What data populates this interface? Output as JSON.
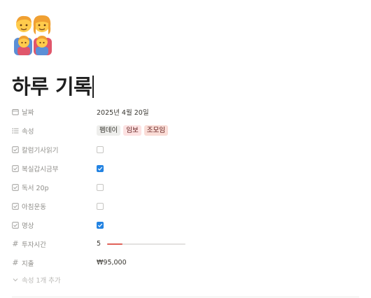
{
  "page": {
    "icon": "family-emoji-icon",
    "title": "하루 기록"
  },
  "properties": [
    {
      "name": "날짜",
      "icon": "calendar-icon",
      "type": "date",
      "value": "2025년 4월 20일"
    },
    {
      "name": "속성",
      "icon": "list-icon",
      "type": "multi_select",
      "tags": [
        {
          "label": "펨데이",
          "color": "#eeeeec"
        },
        {
          "label": "임보",
          "color": "#fde2e2"
        },
        {
          "label": "조모임",
          "color": "#fadcd6"
        }
      ]
    },
    {
      "name": "칼럼기사읽기",
      "icon": "checkbox-icon",
      "type": "checkbox",
      "checked": false
    },
    {
      "name": "복실갑시금부",
      "icon": "checkbox-icon",
      "type": "checkbox",
      "checked": true
    },
    {
      "name": "독서 20p",
      "icon": "checkbox-icon",
      "type": "checkbox",
      "checked": false
    },
    {
      "name": "아침운동",
      "icon": "checkbox-icon",
      "type": "checkbox",
      "checked": false
    },
    {
      "name": "명상",
      "icon": "checkbox-icon",
      "type": "checkbox",
      "checked": true
    },
    {
      "name": "투자시간",
      "icon": "number-icon",
      "type": "number_bar",
      "value": "5",
      "progress": 0.2,
      "bar_color": "#e16259"
    },
    {
      "name": "지출",
      "icon": "number-icon",
      "type": "number",
      "value": "₩95,000"
    }
  ],
  "add_property": {
    "label": "속성 1개 추가",
    "icon": "chevron-down-icon"
  },
  "colors": {
    "checkbox_checked": "#2383e2",
    "text_muted": "#8f8e8a"
  }
}
